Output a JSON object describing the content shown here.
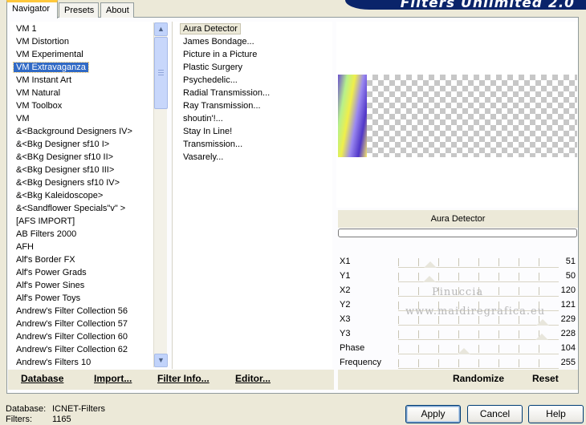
{
  "tabs": [
    {
      "label": "Navigator",
      "active": true
    },
    {
      "label": "Presets",
      "active": false
    },
    {
      "label": "About",
      "active": false
    }
  ],
  "header": {
    "title": "Filters Unlimited 2.0"
  },
  "categories": [
    "VM 1",
    "VM Distortion",
    "VM Experimental",
    "VM Extravaganza",
    "VM Instant Art",
    "VM Natural",
    "VM Toolbox",
    "VM",
    "&<Background Designers IV>",
    "&<Bkg Designer sf10 I>",
    "&<BKg Designer sf10 II>",
    "&<Bkg Designer sf10 III>",
    "&<Bkg Designers sf10 IV>",
    "&<Bkg Kaleidoscope>",
    "&<Sandflower Specials\"v\" >",
    "[AFS IMPORT]",
    "AB Filters 2000",
    "AFH",
    "Alf's Border FX",
    "Alf's Power Grads",
    "Alf's Power Sines",
    "Alf's Power Toys",
    "Andrew's Filter Collection 56",
    "Andrew's Filter Collection 57",
    "Andrew's Filter Collection 60",
    "Andrew's Filter Collection 62",
    "Andrew's Filters 10"
  ],
  "selected_category": "VM Extravaganza",
  "filters": [
    "Aura Detector",
    "James Bondage...",
    "Picture in a Picture",
    "Plastic Surgery",
    "Psychedelic...",
    "Radial Transmission...",
    "Ray Transmission...",
    "shoutin'!...",
    "Stay In Line!",
    "Transmission...",
    "Vasarely..."
  ],
  "selected_filter": "Aura Detector",
  "preview": {
    "filter_name": "Aura Detector"
  },
  "params": [
    {
      "label": "X1",
      "value": "51",
      "fraction": 0.2
    },
    {
      "label": "Y1",
      "value": "50",
      "fraction": 0.196
    },
    {
      "label": "X2",
      "value": "120",
      "fraction": null
    },
    {
      "label": "Y2",
      "value": "121",
      "fraction": null
    },
    {
      "label": "X3",
      "value": "229",
      "fraction": 0.898
    },
    {
      "label": "Y3",
      "value": "228",
      "fraction": 0.894
    },
    {
      "label": "Phase",
      "value": "104",
      "fraction": 0.408
    },
    {
      "label": "Frequency",
      "value": "255",
      "fraction": null
    }
  ],
  "watermark": {
    "line1": "Pinuccia",
    "line2": "www.maidiregrafica.eu"
  },
  "toolbar": {
    "database": "Database",
    "import": "Import...",
    "filter_info": "Filter Info...",
    "editor": "Editor...",
    "randomize": "Randomize",
    "reset": "Reset"
  },
  "status": {
    "database_label": "Database:",
    "database_value": "ICNET-Filters",
    "filters_label": "Filters:",
    "filters_value": "1165"
  },
  "dialog": {
    "apply": "Apply",
    "cancel": "Cancel",
    "help": "Help"
  }
}
